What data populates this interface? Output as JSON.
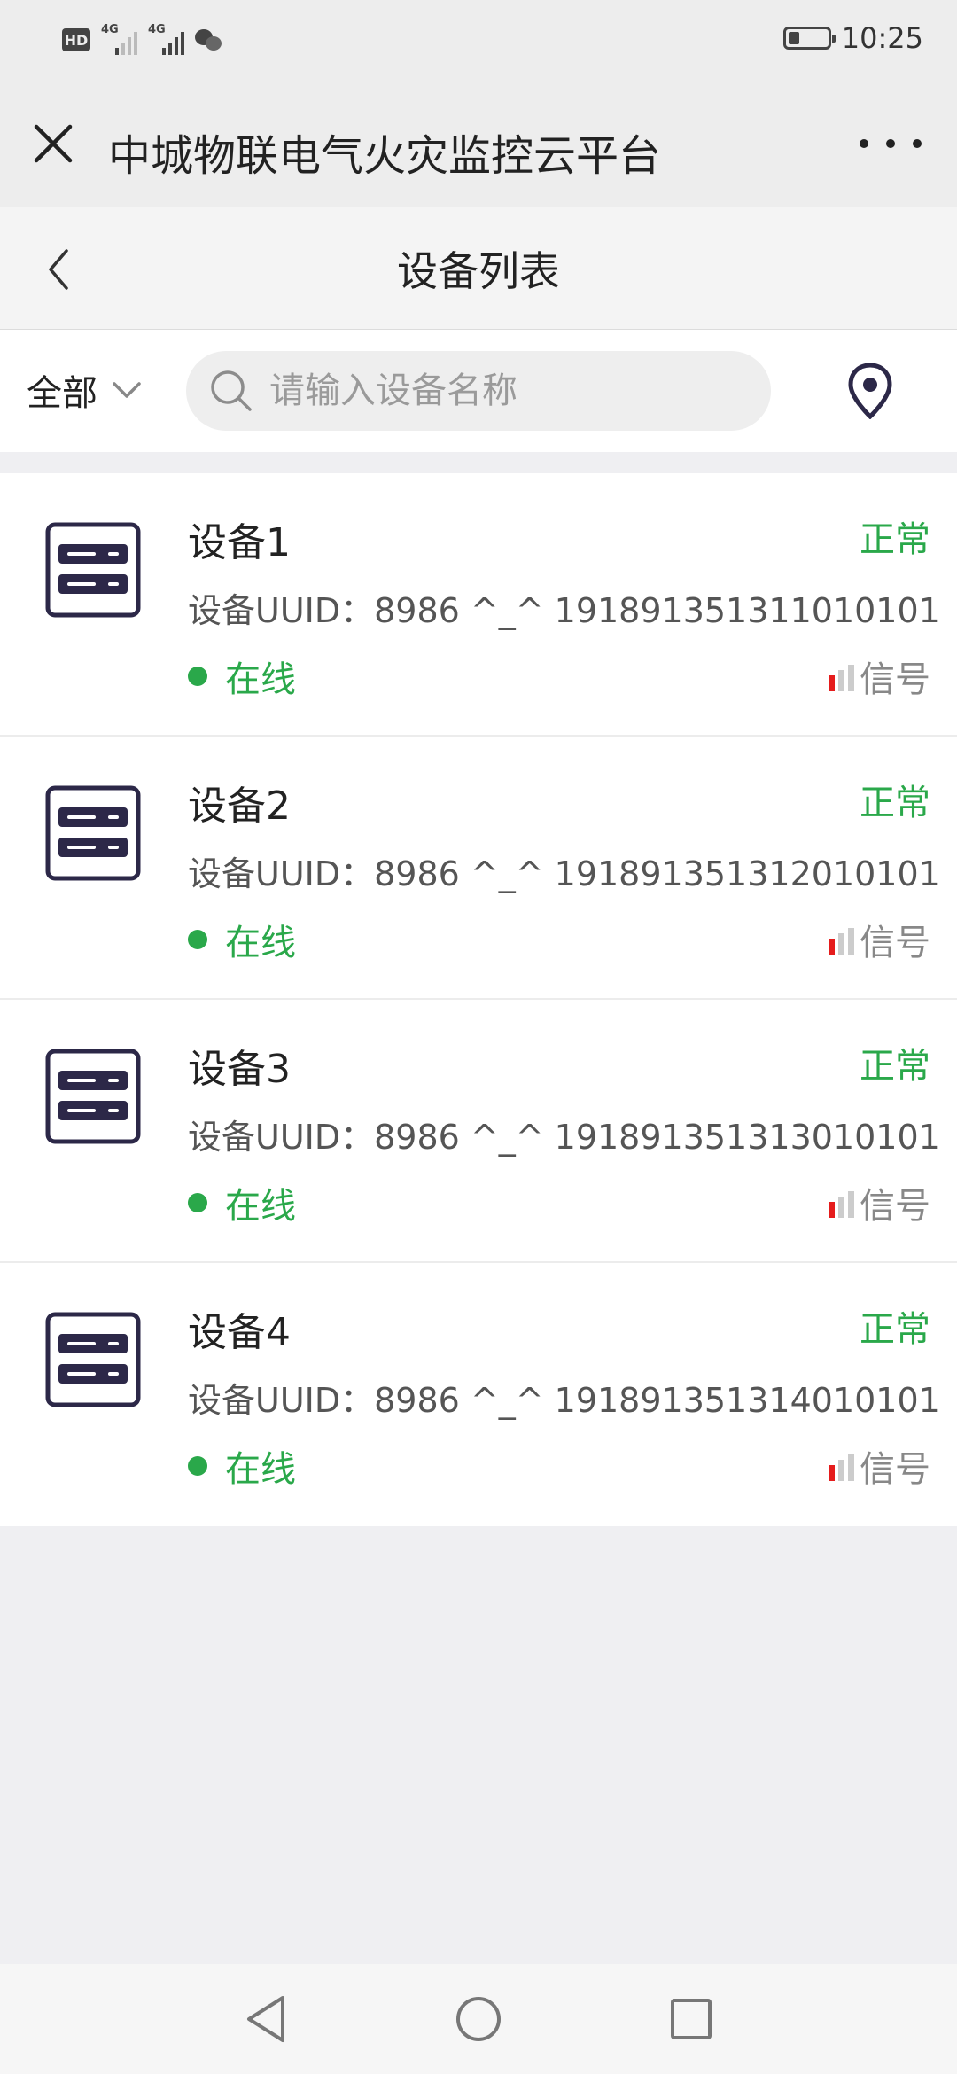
{
  "status_bar": {
    "hd": "HD",
    "network1": "4G",
    "network2": "4G",
    "time": "10:25",
    "battery_level": 0.3
  },
  "wechat_header": {
    "title": "中城物联电气火灾监控云平台"
  },
  "page_header": {
    "title": "设备列表"
  },
  "filter": {
    "selected": "全部",
    "search_placeholder": "请输入设备名称"
  },
  "devices": [
    {
      "name": "设备1",
      "state": "正常",
      "uuid": "设备UUID：8986 ^_^ 191891351311010101",
      "online": "在线",
      "signal_label": "信号",
      "signal_level": "1 of 4"
    },
    {
      "name": "设备2",
      "state": "正常",
      "uuid": "设备UUID：8986 ^_^ 191891351312010101",
      "online": "在线",
      "signal_label": "信号",
      "signal_level": "1 of 4"
    },
    {
      "name": "设备3",
      "state": "正常",
      "uuid": "设备UUID：8986 ^_^ 191891351313010101",
      "online": "在线",
      "signal_label": "信号",
      "signal_level": "1 of 4"
    },
    {
      "name": "设备4",
      "state": "正常",
      "uuid": "设备UUID：8986 ^_^ 191891351314010101",
      "online": "在线",
      "signal_label": "信号",
      "signal_level": "1 of 4"
    }
  ],
  "colors": {
    "accent_green": "#2aa84a",
    "signal_red": "#e51c1c",
    "icon_navy": "#2c2848"
  },
  "icons": {
    "close": "close-icon",
    "more": "more-icon",
    "back": "chevron-left-icon",
    "dropdown": "chevron-down-icon",
    "search": "search-icon",
    "location": "location-pin-icon",
    "device": "server-icon"
  }
}
